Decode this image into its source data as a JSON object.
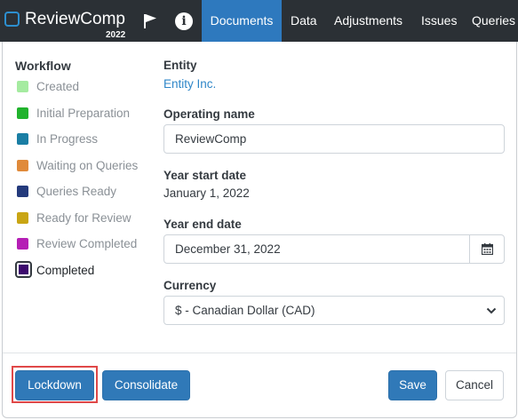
{
  "app": {
    "name": "ReviewComp",
    "year": "2022"
  },
  "nav": {
    "icons": [
      "flag-icon",
      "info-icon"
    ],
    "info_glyph": "i",
    "tabs": [
      {
        "label": "Documents",
        "active": true
      },
      {
        "label": "Data",
        "active": false
      },
      {
        "label": "Adjustments",
        "active": false
      },
      {
        "label": "Issues",
        "active": false
      },
      {
        "label": "Queries",
        "active": false
      }
    ]
  },
  "workflow": {
    "heading": "Workflow",
    "steps": [
      {
        "label": "Created",
        "color": "#a5eba0"
      },
      {
        "label": "Initial Preparation",
        "color": "#21b32d"
      },
      {
        "label": "In Progress",
        "color": "#1a7ea4"
      },
      {
        "label": "Waiting on Queries",
        "color": "#e08a3a"
      },
      {
        "label": "Queries Ready",
        "color": "#243a7c"
      },
      {
        "label": "Ready for Review",
        "color": "#c9a514"
      },
      {
        "label": "Review Completed",
        "color": "#b51fb5"
      },
      {
        "label": "Completed",
        "color": "#3d0a6e",
        "current": true
      }
    ]
  },
  "form": {
    "entity": {
      "label": "Entity",
      "value": "Entity Inc."
    },
    "operating_name": {
      "label": "Operating name",
      "value": "ReviewComp"
    },
    "year_start": {
      "label": "Year start date",
      "value": "January 1, 2022"
    },
    "year_end": {
      "label": "Year end date",
      "value": "December 31, 2022"
    },
    "currency": {
      "label": "Currency",
      "value": "$ - Canadian Dollar (CAD)"
    }
  },
  "buttons": {
    "lockdown": "Lockdown",
    "consolidate": "Consolidate",
    "save": "Save",
    "cancel": "Cancel"
  },
  "colors": {
    "navbar": "#2b3035",
    "active_tab": "#2e79be",
    "primary_button": "#3079b8",
    "highlight": "#e04848",
    "link": "#2e86c8"
  }
}
